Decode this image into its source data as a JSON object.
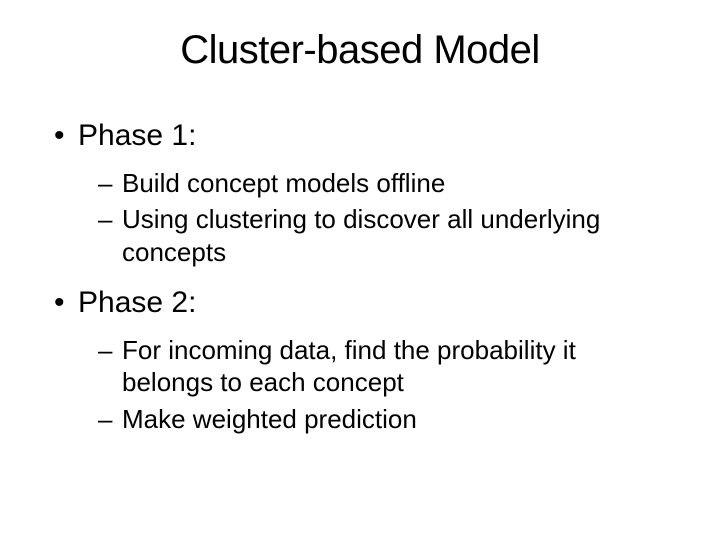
{
  "title": "Cluster-based Model",
  "bullets": [
    {
      "level": 1,
      "text": "Phase 1:"
    },
    {
      "level": 2,
      "text": "Build concept models offline"
    },
    {
      "level": 2,
      "text": "Using clustering to discover all underlying concepts"
    },
    {
      "level": 1,
      "text": "Phase 2:"
    },
    {
      "level": 2,
      "text": "For incoming data, find the probability it belongs to each concept"
    },
    {
      "level": 2,
      "text": "Make weighted prediction"
    }
  ]
}
